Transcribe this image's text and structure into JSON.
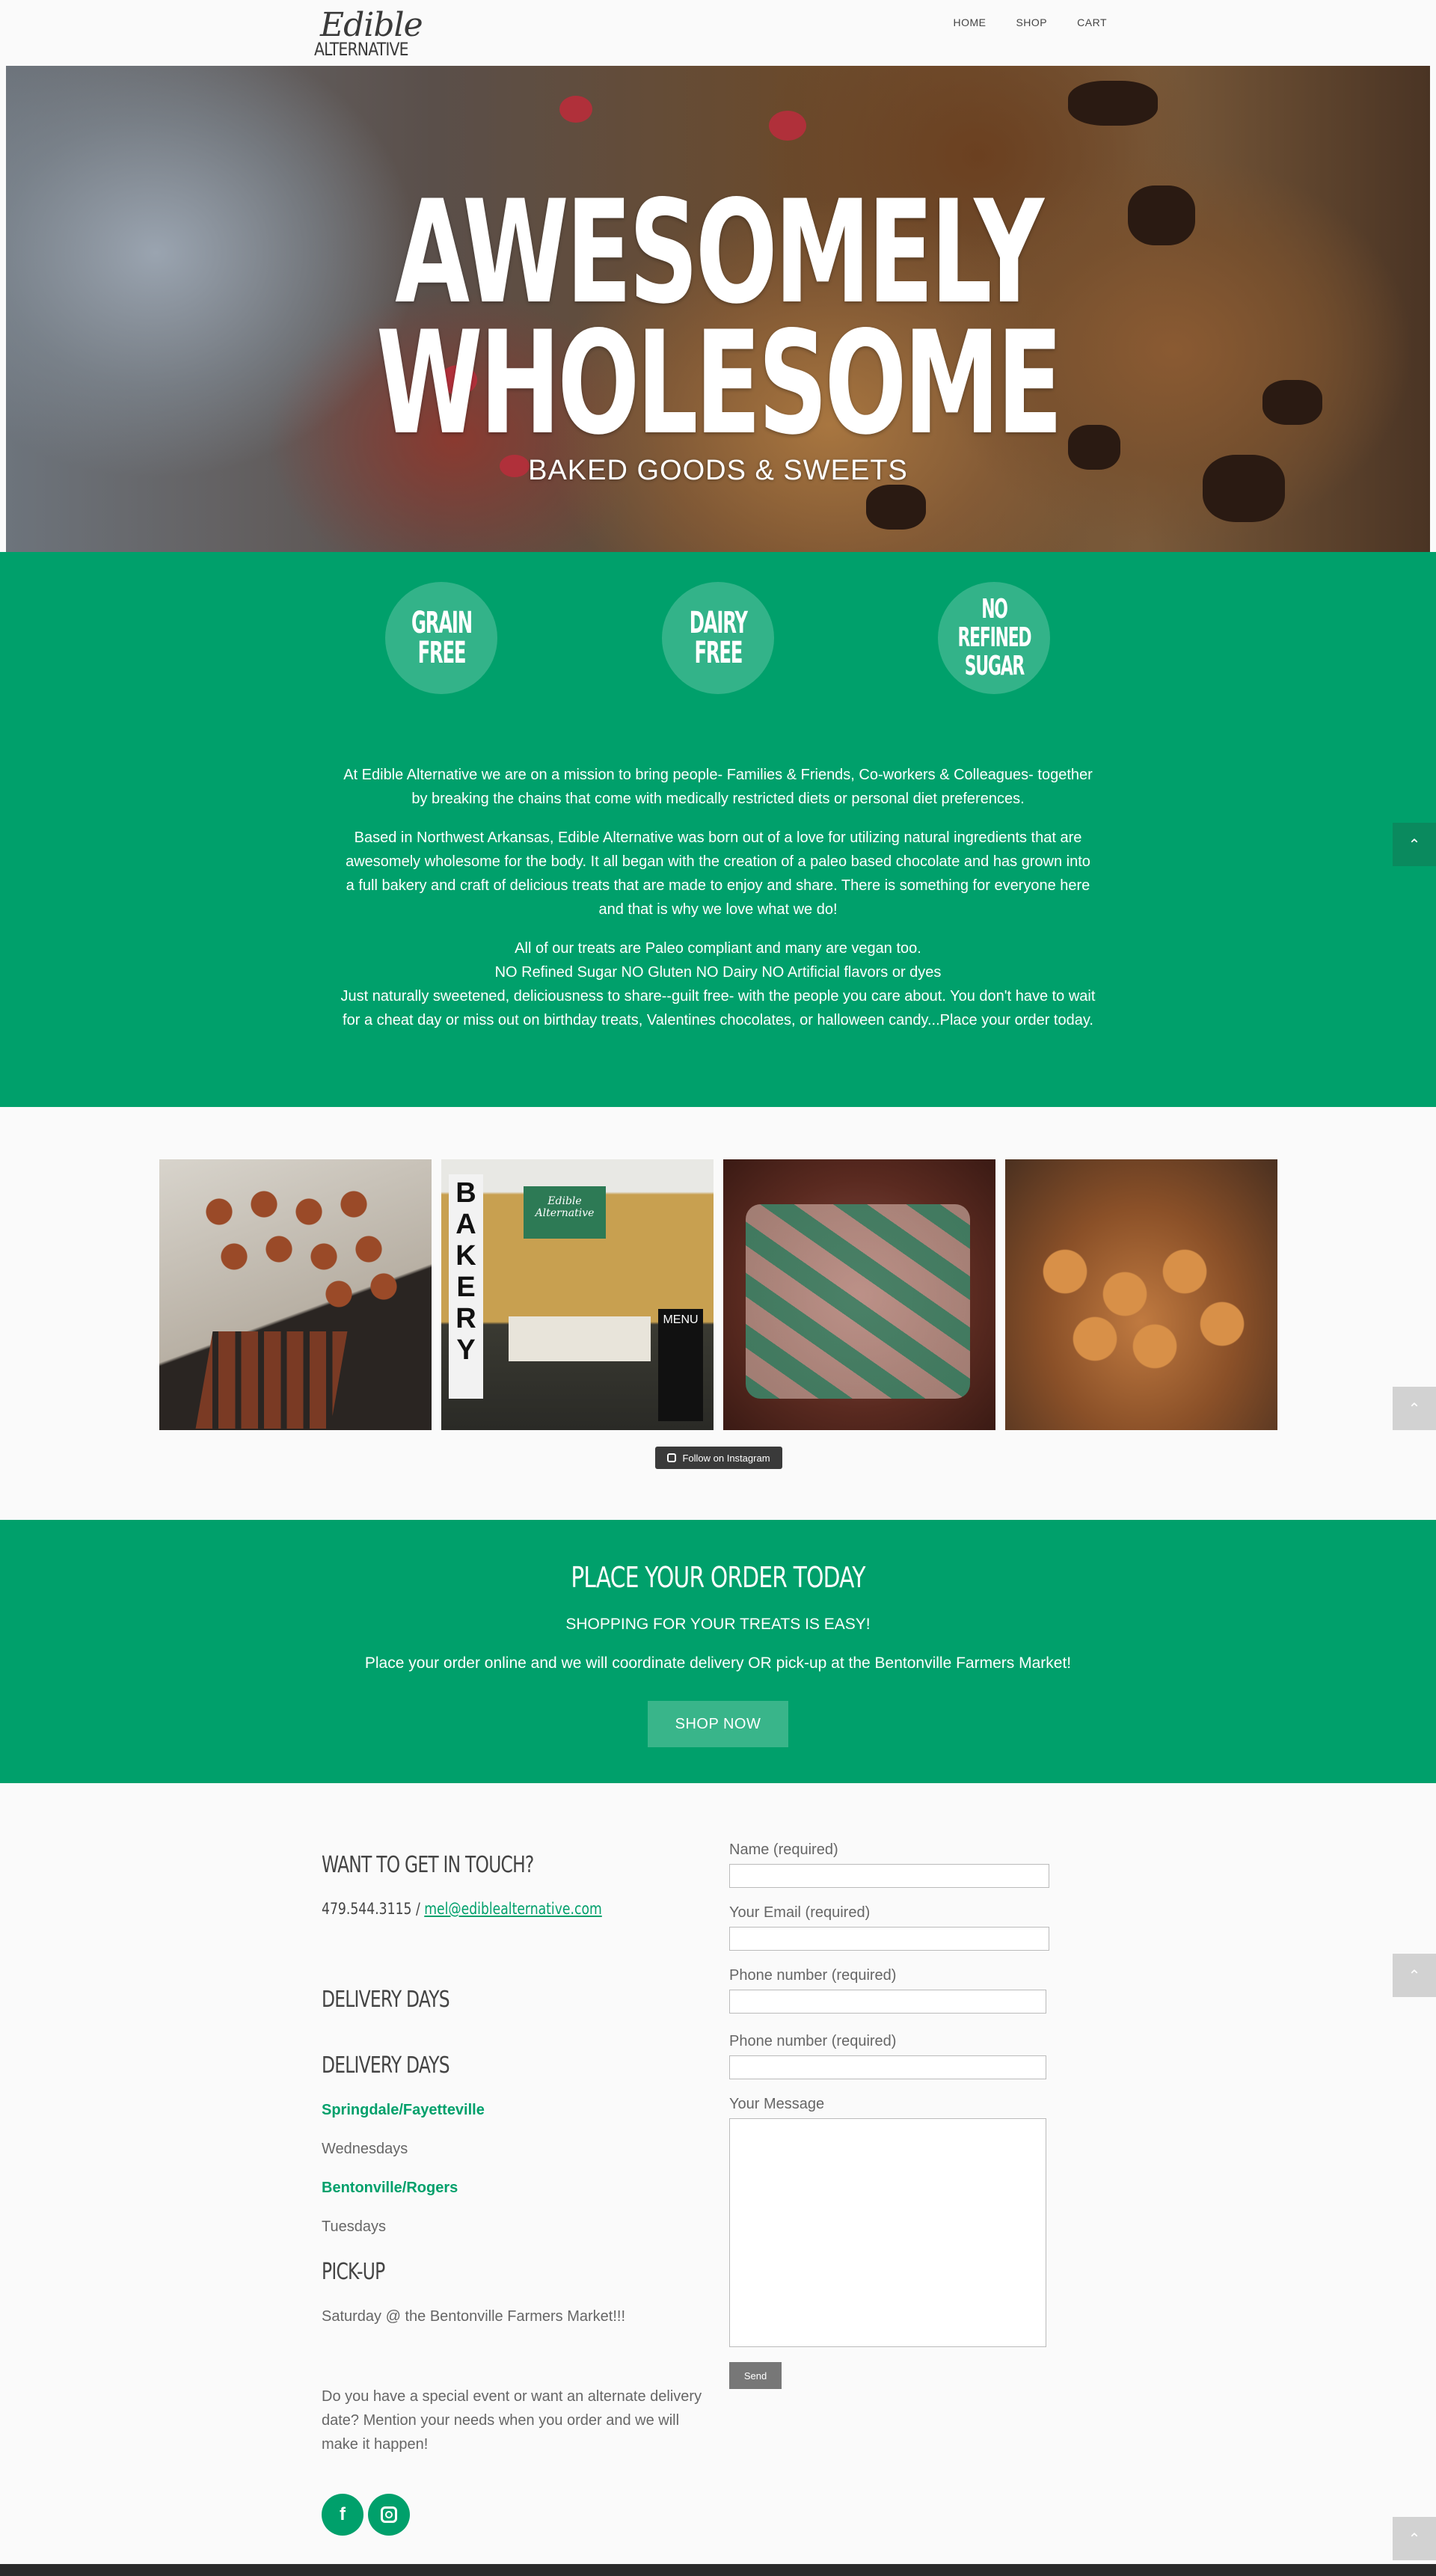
{
  "header": {
    "logo_line1": "Edible",
    "logo_line2": "ALTERNATIVE",
    "nav": [
      "HOME",
      "SHOP",
      "CART"
    ]
  },
  "hero": {
    "title_line1": "AWESOMELY",
    "title_line2": "WHOLESOME",
    "subtitle": "BAKED GOODS & SWEETS"
  },
  "badges": [
    {
      "line1": "GRAIN",
      "line2": "FREE",
      "line3": ""
    },
    {
      "line1": "DAIRY",
      "line2": "FREE",
      "line3": ""
    },
    {
      "line1": "NO",
      "line2": "REFINED",
      "line3": "SUGAR"
    }
  ],
  "about": {
    "p1": "At Edible Alternative we are on a mission to bring people- Families & Friends, Co-workers & Colleagues- together by breaking the chains that come with medically restricted diets or personal diet preferences.",
    "p2": "Based in Northwest Arkansas, Edible Alternative was born out of a love for utilizing natural ingredients that are awesomely wholesome for the body. It all began with the creation of a paleo based chocolate and has grown into a full bakery and craft of delicious treats that are made to enjoy and share. There is something for everyone here and that is why we love what we do!",
    "p3a": "All of our treats are Paleo compliant and many are vegan too.",
    "p3b": "NO Refined Sugar NO Gluten NO Dairy NO Artificial flavors or dyes",
    "p3c": "Just naturally sweetened, deliciousness to share--guilt free- with the people you care about. You don't have to wait for a cheat day or miss out on birthday treats, Valentines chocolates, or halloween candy...Place your order today."
  },
  "instagram": {
    "follow_label": "Follow on Instagram",
    "booth_sign": "BAKERY",
    "menu_sign": "MENU",
    "banner_text": "Edible Alternative"
  },
  "order": {
    "title": "PLACE YOUR ORDER TODAY",
    "subtitle": "SHOPPING FOR YOUR TREATS IS EASY!",
    "description": "Place your order online and we will coordinate delivery OR pick-up at the Bentonville Farmers Market!",
    "button": "SHOP NOW"
  },
  "contact": {
    "heading": "WANT TO GET IN TOUCH?",
    "phone": "479.544.3115 / ",
    "email": "mel@ediblealternative.com",
    "delivery_heading_1": "DELIVERY DAYS",
    "delivery_heading_2": "DELIVERY DAYS",
    "area1": "Springdale/Fayetteville",
    "area1_day": "Wednesdays",
    "area2": "Bentonville/Rogers",
    "area2_day": "Tuesdays",
    "pickup_heading": "PICK-UP",
    "pickup_text": "Saturday @ the Bentonville Farmers Market!!!",
    "special": "Do you have a special event or want an alternate delivery date? Mention your needs when you order and we will make it happen!"
  },
  "form": {
    "name_label": "Name (required)",
    "email_label": "Your Email (required)",
    "phone_label_1": "Phone number (required)",
    "phone_label_2": "Phone number (required)",
    "message_label": "Your Message",
    "send": "Send"
  },
  "social": {
    "facebook": "f",
    "instagram": "instagram"
  },
  "colors": {
    "brand_green": "#00a06b",
    "badge_green": "#33b389",
    "button_green": "#39b58a"
  }
}
